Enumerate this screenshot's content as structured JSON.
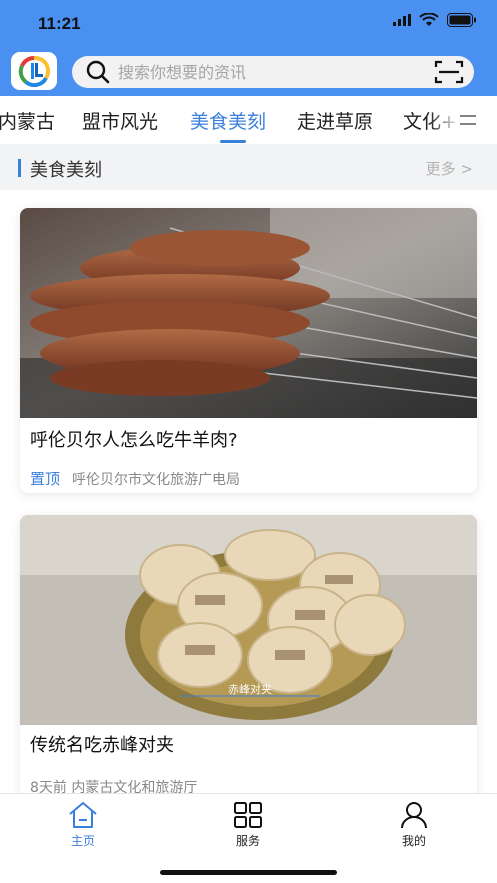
{
  "status": {
    "time": "11:21",
    "icons": [
      "signal-icon",
      "wifi-icon",
      "battery-icon"
    ]
  },
  "header": {
    "logo_icon": "app-logo-icon",
    "search": {
      "placeholder": "搜索你想要的资讯",
      "icon": "search-icon"
    },
    "scan_icon": "scan-icon"
  },
  "tabs": [
    {
      "label": "内蒙古",
      "active": false
    },
    {
      "label": "盟市风光",
      "active": false
    },
    {
      "label": "美食美刻",
      "active": true
    },
    {
      "label": "走进草原",
      "active": false
    },
    {
      "label": "文化+",
      "active": false
    }
  ],
  "menu_icon": "menu-icon",
  "section": {
    "title": "美食美刻",
    "more": "更多 >"
  },
  "cards": [
    {
      "title": "呼伦贝尔人怎么吃牛羊肉?",
      "pin": "置顶",
      "source": "呼伦贝尔市文化旅游广电局",
      "image": "grilled-skewers-photo"
    },
    {
      "title": "传统名吃赤峰对夹",
      "time": "8天前",
      "source": "内蒙古文化和旅游厅",
      "image": "duijia-pastry-photo",
      "image_caption": "赤峰对夹"
    }
  ],
  "bottom_nav": [
    {
      "label": "主页",
      "icon": "home-icon",
      "active": true
    },
    {
      "label": "服务",
      "icon": "grid-icon",
      "active": false
    },
    {
      "label": "我的",
      "icon": "user-icon",
      "active": false
    }
  ],
  "colors": {
    "brand": "#4a90f0",
    "accent": "#3b7fdc"
  }
}
